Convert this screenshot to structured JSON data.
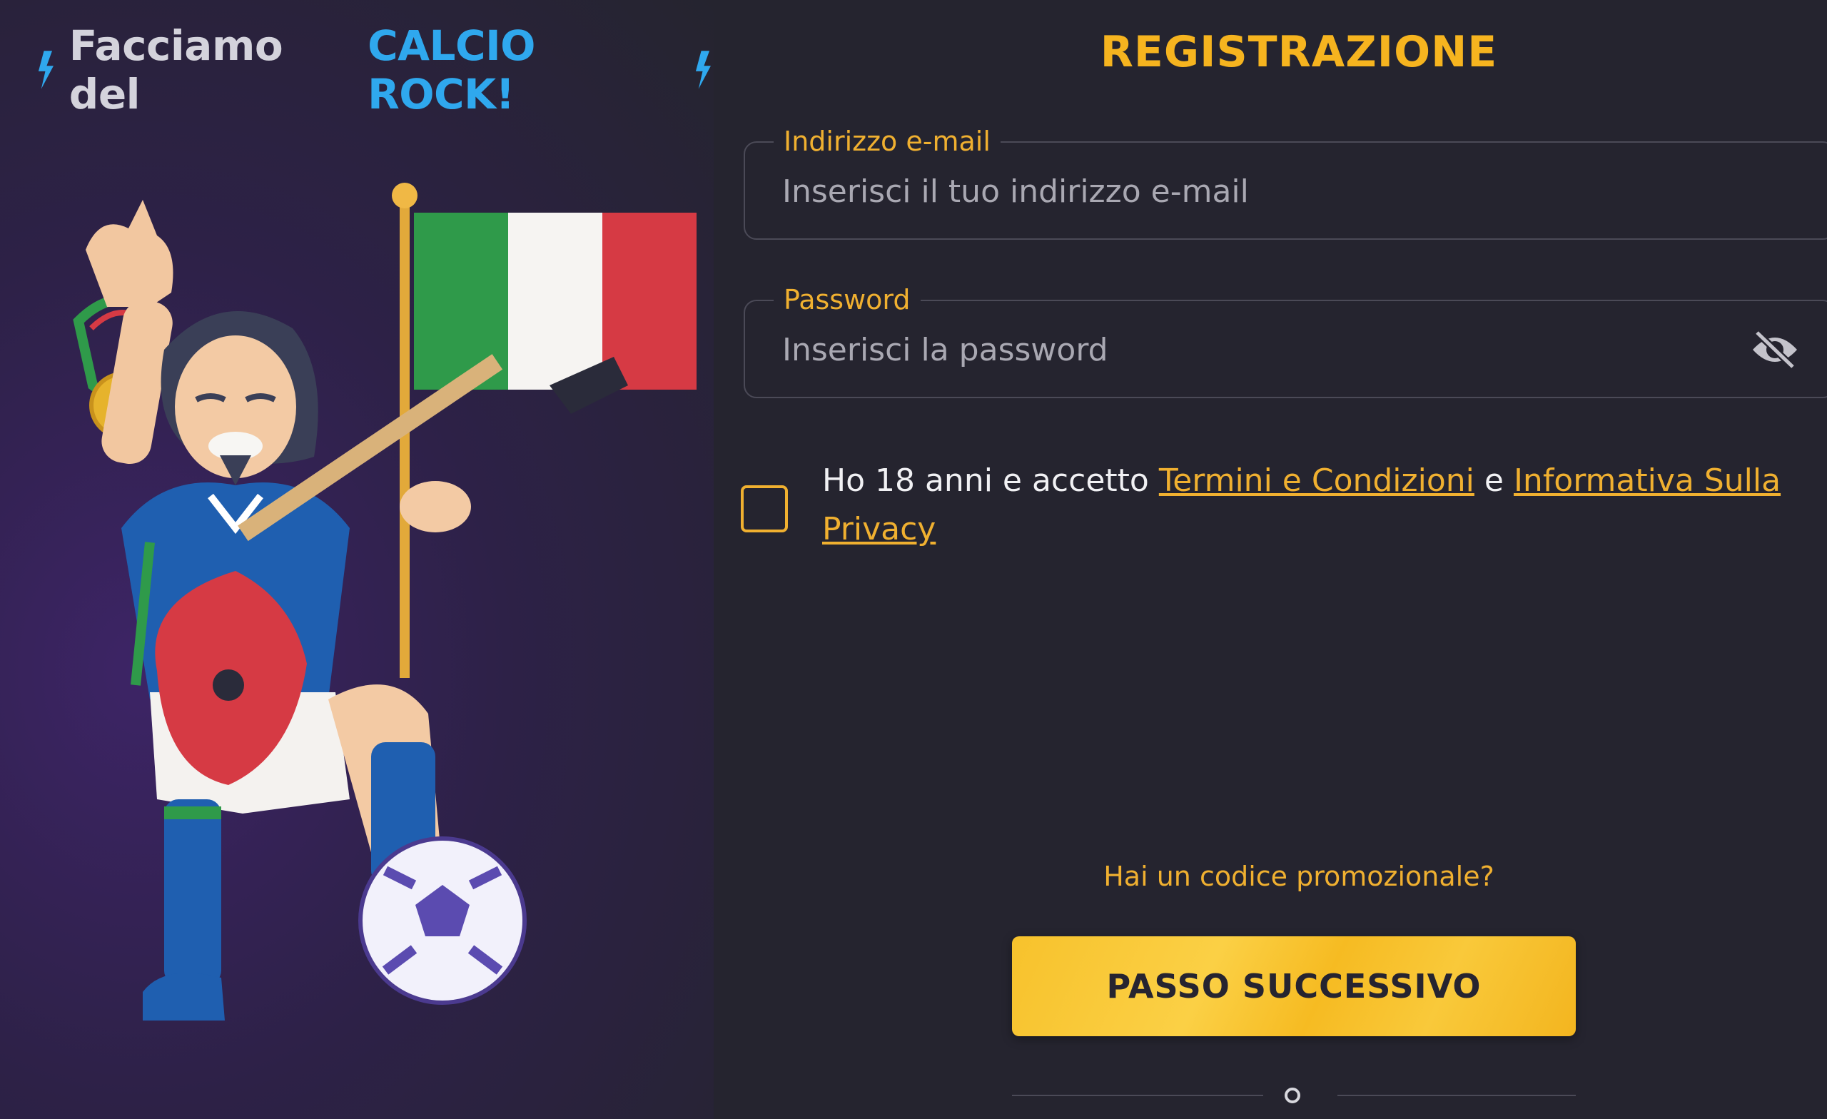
{
  "promo": {
    "tagline_prefix": "Facciamo del",
    "tagline_accent": "CALCIO ROCK!"
  },
  "form": {
    "title": "REGISTRAZIONE",
    "email": {
      "label": "Indirizzo e-mail",
      "placeholder": "Inserisci il tuo indirizzo e-mail",
      "value": ""
    },
    "password": {
      "label": "Password",
      "placeholder": "Inserisci la password",
      "value": "",
      "toggle_icon": "eye-slash-icon"
    },
    "consent": {
      "checked": false,
      "text_before": "Ho 18 anni e accetto",
      "terms_link": "Termini e Condizioni",
      "conjunction": "e",
      "privacy_link": "Informativa Sulla Privacy"
    },
    "promo_code_link": "Hai un codice promozionale?",
    "next_button": "PASSO SUCCESSIVO",
    "pagination": {
      "current_step": 1
    }
  },
  "colors": {
    "accent": "#f0b030",
    "button": "#f7c22c",
    "tagline_accent": "#2fa8ee",
    "background": "#25242f"
  }
}
